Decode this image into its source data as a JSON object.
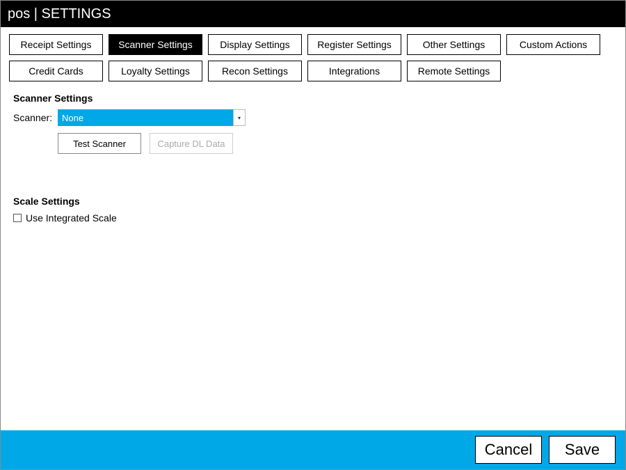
{
  "titlebar": {
    "text": "pos | SETTINGS"
  },
  "tabs": {
    "active_index": 1,
    "items": [
      {
        "label": "Receipt Settings"
      },
      {
        "label": "Scanner Settings"
      },
      {
        "label": "Display Settings"
      },
      {
        "label": "Register Settings"
      },
      {
        "label": "Other Settings"
      },
      {
        "label": "Custom Actions"
      },
      {
        "label": "Credit Cards"
      },
      {
        "label": "Loyalty Settings"
      },
      {
        "label": "Recon Settings"
      },
      {
        "label": "Integrations"
      },
      {
        "label": "Remote Settings"
      }
    ]
  },
  "scanner_section": {
    "title": "Scanner Settings",
    "scanner_label": "Scanner:",
    "scanner_value": "None",
    "test_button": "Test Scanner",
    "capture_button": "Capture DL Data"
  },
  "scale_section": {
    "title": "Scale Settings",
    "checkbox_label": "Use Integrated Scale",
    "checked": false
  },
  "footer": {
    "cancel": "Cancel",
    "save": "Save"
  },
  "colors": {
    "accent": "#00a8e8"
  }
}
